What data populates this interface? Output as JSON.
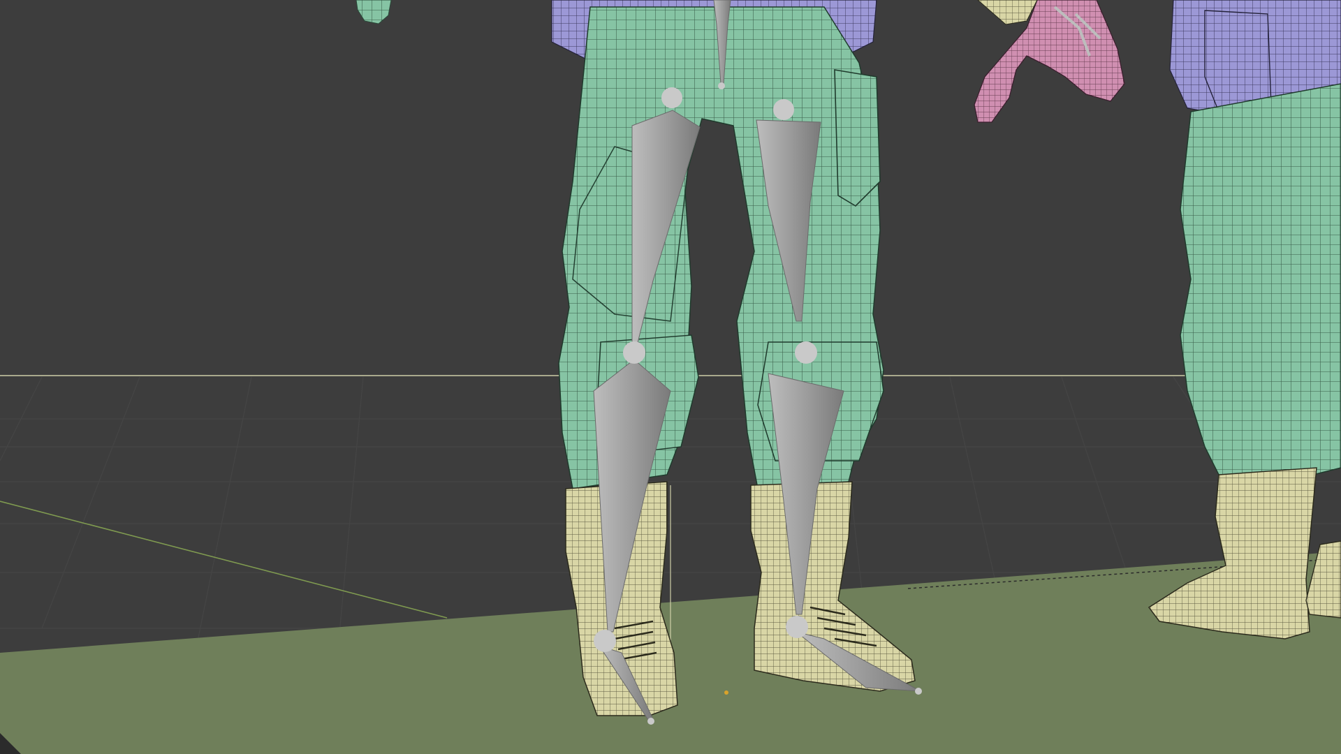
{
  "viewport": {
    "mode": "pose-mode",
    "display": "wireframe-overlay",
    "colors": {
      "background": "#3d3d3d",
      "grid_line": "#474747",
      "horizon_axis": "#cfcfa8",
      "floor_axis": "#7f9a50",
      "ground_plane": "#6f7f5a",
      "pants": "#86c4a4",
      "pants_wire": "#1f3a2c",
      "boots": "#d9d6a6",
      "boots_wire": "#2b2a1c",
      "vest": "#9c98d6",
      "vest_wire": "#24223a",
      "gloves": "#d08fb1",
      "gloves_wire": "#3b1f2e",
      "bone": "#9d9d9d",
      "bone_light": "#bdbdbd",
      "bone_dark": "#7a7a7a",
      "joint": "#c9c9c9",
      "origin_point": "#d9a22b"
    },
    "bones": [
      {
        "name": "thigh-left-bone"
      },
      {
        "name": "shin-left-bone"
      },
      {
        "name": "foot-left-bone"
      },
      {
        "name": "thigh-right-bone"
      },
      {
        "name": "shin-right-bone"
      },
      {
        "name": "foot-right-bone"
      },
      {
        "name": "spine-bone"
      }
    ]
  }
}
